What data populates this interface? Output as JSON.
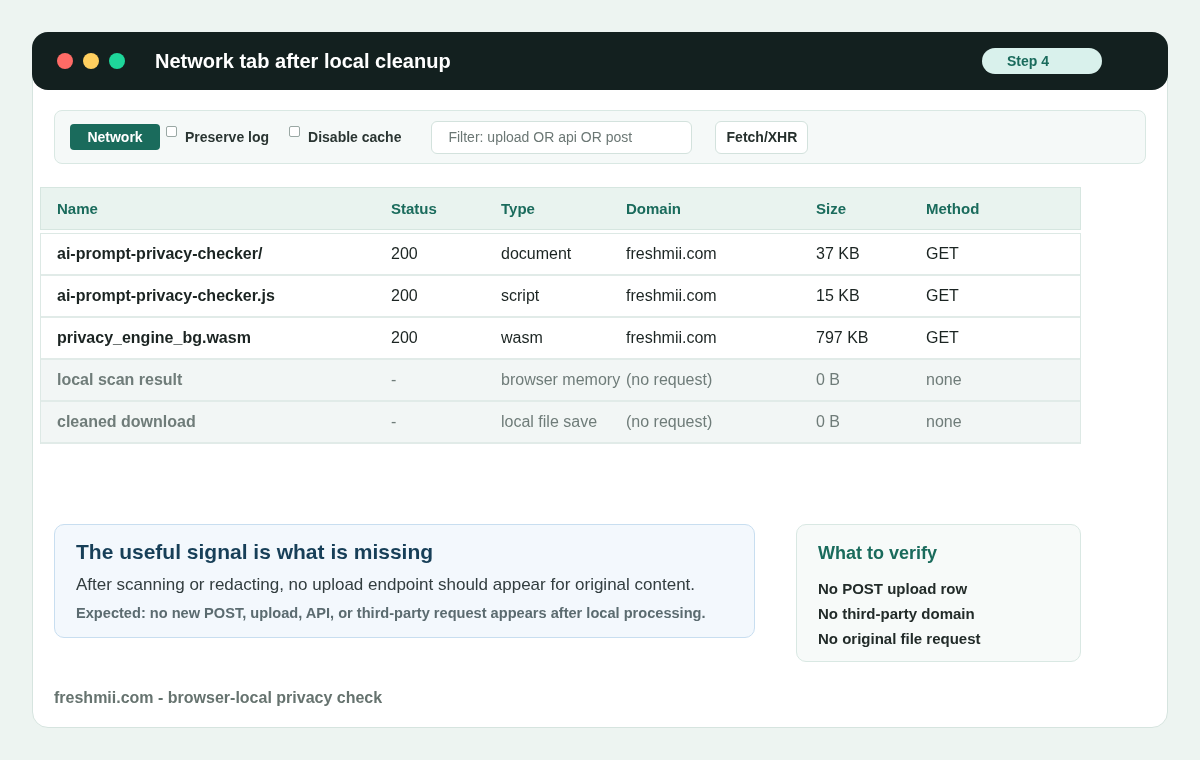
{
  "window": {
    "title": "Network tab after local cleanup",
    "step": "Step 4"
  },
  "toolbar": {
    "panel_button": "Network",
    "checkboxes": [
      {
        "label": "Preserve log",
        "checked": false
      },
      {
        "label": "Disable cache",
        "checked": false
      }
    ],
    "filter": {
      "placeholder": "Filter: upload OR api OR post"
    },
    "type_filter": "Fetch/XHR"
  },
  "table": {
    "columns": [
      "Name",
      "Status",
      "Type",
      "Domain",
      "Size",
      "Method"
    ],
    "rows": [
      {
        "kind": "request",
        "cells": [
          "ai-prompt-privacy-checker/",
          "200",
          "document",
          "freshmii.com",
          "37 KB",
          "GET"
        ]
      },
      {
        "kind": "request",
        "cells": [
          "ai-prompt-privacy-checker.js",
          "200",
          "script",
          "freshmii.com",
          "15 KB",
          "GET"
        ]
      },
      {
        "kind": "request",
        "cells": [
          "privacy_engine_bg.wasm",
          "200",
          "wasm",
          "freshmii.com",
          "797 KB",
          "GET"
        ]
      },
      {
        "kind": "local",
        "cells": [
          "local scan result",
          "-",
          "browser memory",
          "(no request)",
          "0 B",
          "none"
        ]
      },
      {
        "kind": "local",
        "cells": [
          "cleaned download",
          "-",
          "local file save",
          "(no request)",
          "0 B",
          "none"
        ]
      }
    ]
  },
  "note": {
    "title": "The useful signal is what is missing",
    "body": "After scanning or redacting, no upload endpoint should appear for original content.",
    "expected": "Expected: no new POST, upload, API, or third-party request appears after local processing."
  },
  "verify": {
    "title": "What to verify",
    "items": [
      "No POST upload row",
      "No third-party domain",
      "No original file request"
    ]
  },
  "footer": "freshmii.com - browser-local privacy check"
}
